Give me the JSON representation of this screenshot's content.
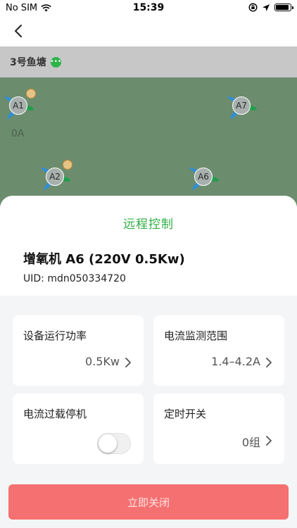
{
  "status_bar": {
    "carrier": "No SIM",
    "time": "15:39",
    "battery_level": 0.9
  },
  "nav": {
    "back_icon": "chevron-left-icon"
  },
  "pond": {
    "title": "3号鱼塘",
    "badge_icon": "more-dots-icon",
    "aerators": [
      {
        "label": "A1",
        "has_timer": true,
        "current": "0A"
      },
      {
        "label": "A7",
        "has_timer": false
      },
      {
        "label": "A2",
        "has_timer": true
      },
      {
        "label": "A6",
        "has_timer": false
      }
    ],
    "colors": {
      "background": "#6c8c6e",
      "fan_blue": "#2f8fd6",
      "fan_green": "#1f9e4a"
    }
  },
  "sheet": {
    "title": "远程控制",
    "device_name": "增氧机 A6 (220V 0.5Kw)",
    "uid": "UID: mdn050334720",
    "cards": {
      "power": {
        "label": "设备运行功率",
        "value": "0.5Kw"
      },
      "current_range": {
        "label": "电流监测范围",
        "value": "1.4–4.2A"
      },
      "overload_stop": {
        "label": "电流过载停机",
        "enabled": false
      },
      "timer_switch": {
        "label": "定时开关",
        "value": "0组"
      }
    },
    "close_button": "立即关闭",
    "colors": {
      "accent_green": "#2fae45",
      "close_red": "#f57070"
    }
  }
}
